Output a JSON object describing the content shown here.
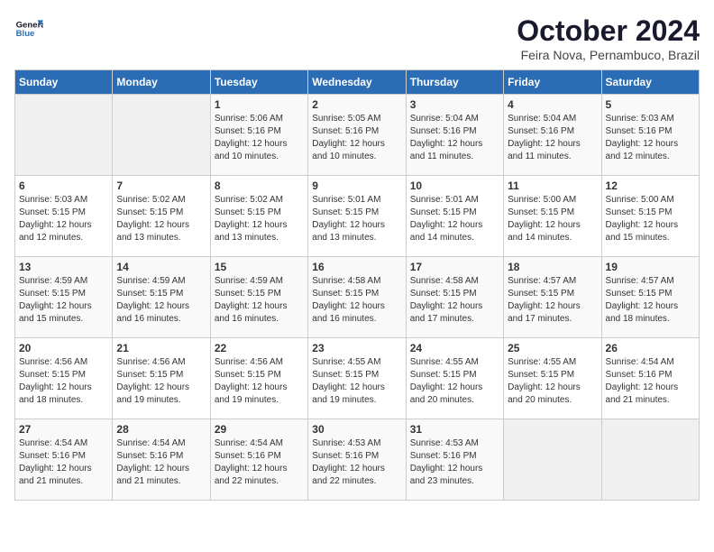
{
  "header": {
    "logo_line1": "General",
    "logo_line2": "Blue",
    "month_title": "October 2024",
    "subtitle": "Feira Nova, Pernambuco, Brazil"
  },
  "days_of_week": [
    "Sunday",
    "Monday",
    "Tuesday",
    "Wednesday",
    "Thursday",
    "Friday",
    "Saturday"
  ],
  "weeks": [
    [
      {
        "day": "",
        "content": ""
      },
      {
        "day": "",
        "content": ""
      },
      {
        "day": "1",
        "content": "Sunrise: 5:06 AM\nSunset: 5:16 PM\nDaylight: 12 hours\nand 10 minutes."
      },
      {
        "day": "2",
        "content": "Sunrise: 5:05 AM\nSunset: 5:16 PM\nDaylight: 12 hours\nand 10 minutes."
      },
      {
        "day": "3",
        "content": "Sunrise: 5:04 AM\nSunset: 5:16 PM\nDaylight: 12 hours\nand 11 minutes."
      },
      {
        "day": "4",
        "content": "Sunrise: 5:04 AM\nSunset: 5:16 PM\nDaylight: 12 hours\nand 11 minutes."
      },
      {
        "day": "5",
        "content": "Sunrise: 5:03 AM\nSunset: 5:16 PM\nDaylight: 12 hours\nand 12 minutes."
      }
    ],
    [
      {
        "day": "6",
        "content": "Sunrise: 5:03 AM\nSunset: 5:15 PM\nDaylight: 12 hours\nand 12 minutes."
      },
      {
        "day": "7",
        "content": "Sunrise: 5:02 AM\nSunset: 5:15 PM\nDaylight: 12 hours\nand 13 minutes."
      },
      {
        "day": "8",
        "content": "Sunrise: 5:02 AM\nSunset: 5:15 PM\nDaylight: 12 hours\nand 13 minutes."
      },
      {
        "day": "9",
        "content": "Sunrise: 5:01 AM\nSunset: 5:15 PM\nDaylight: 12 hours\nand 13 minutes."
      },
      {
        "day": "10",
        "content": "Sunrise: 5:01 AM\nSunset: 5:15 PM\nDaylight: 12 hours\nand 14 minutes."
      },
      {
        "day": "11",
        "content": "Sunrise: 5:00 AM\nSunset: 5:15 PM\nDaylight: 12 hours\nand 14 minutes."
      },
      {
        "day": "12",
        "content": "Sunrise: 5:00 AM\nSunset: 5:15 PM\nDaylight: 12 hours\nand 15 minutes."
      }
    ],
    [
      {
        "day": "13",
        "content": "Sunrise: 4:59 AM\nSunset: 5:15 PM\nDaylight: 12 hours\nand 15 minutes."
      },
      {
        "day": "14",
        "content": "Sunrise: 4:59 AM\nSunset: 5:15 PM\nDaylight: 12 hours\nand 16 minutes."
      },
      {
        "day": "15",
        "content": "Sunrise: 4:59 AM\nSunset: 5:15 PM\nDaylight: 12 hours\nand 16 minutes."
      },
      {
        "day": "16",
        "content": "Sunrise: 4:58 AM\nSunset: 5:15 PM\nDaylight: 12 hours\nand 16 minutes."
      },
      {
        "day": "17",
        "content": "Sunrise: 4:58 AM\nSunset: 5:15 PM\nDaylight: 12 hours\nand 17 minutes."
      },
      {
        "day": "18",
        "content": "Sunrise: 4:57 AM\nSunset: 5:15 PM\nDaylight: 12 hours\nand 17 minutes."
      },
      {
        "day": "19",
        "content": "Sunrise: 4:57 AM\nSunset: 5:15 PM\nDaylight: 12 hours\nand 18 minutes."
      }
    ],
    [
      {
        "day": "20",
        "content": "Sunrise: 4:56 AM\nSunset: 5:15 PM\nDaylight: 12 hours\nand 18 minutes."
      },
      {
        "day": "21",
        "content": "Sunrise: 4:56 AM\nSunset: 5:15 PM\nDaylight: 12 hours\nand 19 minutes."
      },
      {
        "day": "22",
        "content": "Sunrise: 4:56 AM\nSunset: 5:15 PM\nDaylight: 12 hours\nand 19 minutes."
      },
      {
        "day": "23",
        "content": "Sunrise: 4:55 AM\nSunset: 5:15 PM\nDaylight: 12 hours\nand 19 minutes."
      },
      {
        "day": "24",
        "content": "Sunrise: 4:55 AM\nSunset: 5:15 PM\nDaylight: 12 hours\nand 20 minutes."
      },
      {
        "day": "25",
        "content": "Sunrise: 4:55 AM\nSunset: 5:15 PM\nDaylight: 12 hours\nand 20 minutes."
      },
      {
        "day": "26",
        "content": "Sunrise: 4:54 AM\nSunset: 5:16 PM\nDaylight: 12 hours\nand 21 minutes."
      }
    ],
    [
      {
        "day": "27",
        "content": "Sunrise: 4:54 AM\nSunset: 5:16 PM\nDaylight: 12 hours\nand 21 minutes."
      },
      {
        "day": "28",
        "content": "Sunrise: 4:54 AM\nSunset: 5:16 PM\nDaylight: 12 hours\nand 21 minutes."
      },
      {
        "day": "29",
        "content": "Sunrise: 4:54 AM\nSunset: 5:16 PM\nDaylight: 12 hours\nand 22 minutes."
      },
      {
        "day": "30",
        "content": "Sunrise: 4:53 AM\nSunset: 5:16 PM\nDaylight: 12 hours\nand 22 minutes."
      },
      {
        "day": "31",
        "content": "Sunrise: 4:53 AM\nSunset: 5:16 PM\nDaylight: 12 hours\nand 23 minutes."
      },
      {
        "day": "",
        "content": ""
      },
      {
        "day": "",
        "content": ""
      }
    ]
  ]
}
